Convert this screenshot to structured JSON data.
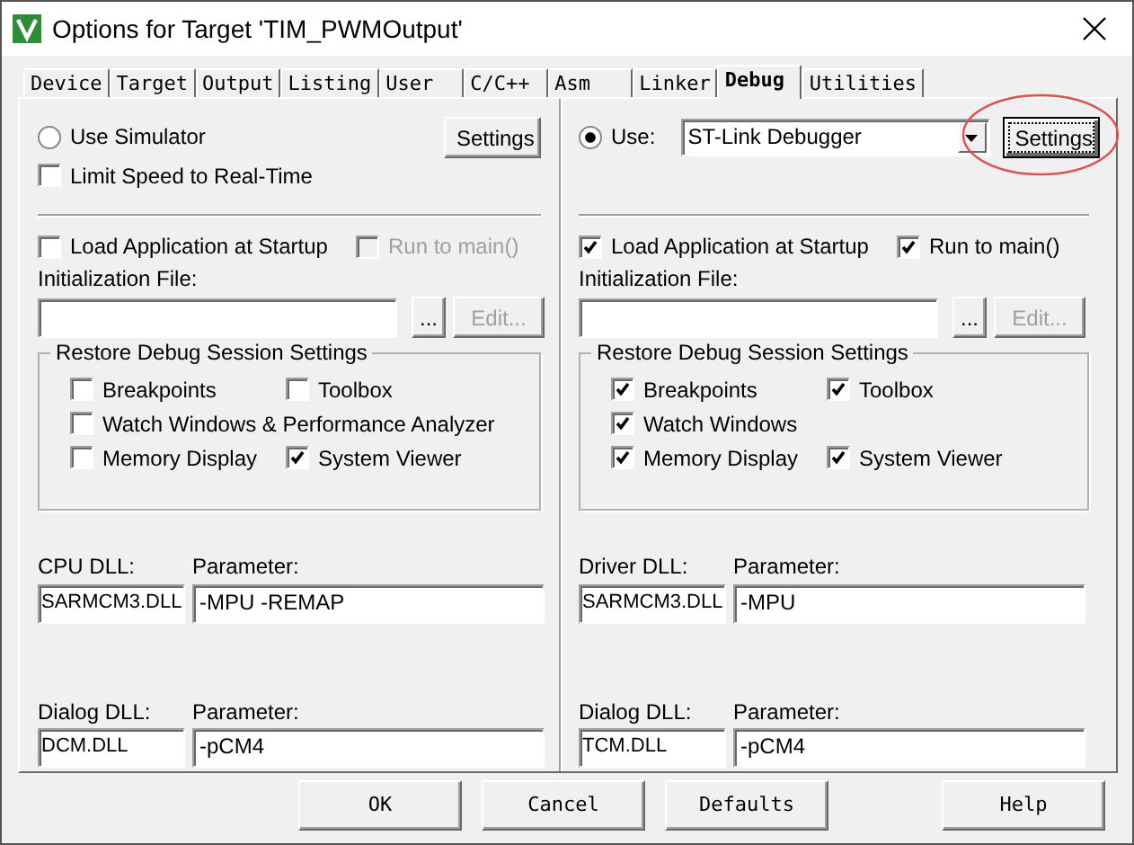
{
  "window": {
    "title": "Options for Target 'TIM_PWMOutput'"
  },
  "tabs": [
    {
      "label": "Device",
      "selected": false
    },
    {
      "label": "Target",
      "selected": false
    },
    {
      "label": "Output",
      "selected": false
    },
    {
      "label": "Listing",
      "selected": false
    },
    {
      "label": "User",
      "selected": false
    },
    {
      "label": "C/C++",
      "selected": false
    },
    {
      "label": "Asm",
      "selected": false
    },
    {
      "label": "Linker",
      "selected": false
    },
    {
      "label": "Debug",
      "selected": true
    },
    {
      "label": "Utilities",
      "selected": false
    }
  ],
  "panels": [
    {
      "radio": {
        "label": "Use Simulator",
        "selected": false
      },
      "settings_button": {
        "label": "Settings",
        "focused": false
      },
      "limit_speed": {
        "label": "Limit Speed to Real-Time",
        "checked": false
      },
      "load_app": {
        "label": "Load Application at Startup",
        "checked": false,
        "disabled": false
      },
      "run_to_main": {
        "label": "Run to main()",
        "checked": false,
        "disabled": true
      },
      "init_label": "Initialization File:",
      "browse_button": "...",
      "edit_button": {
        "label": "Edit...",
        "disabled": true
      },
      "restore": {
        "title": "Restore Debug Session Settings",
        "rows": [
          [
            {
              "label": "Breakpoints",
              "checked": false
            },
            {
              "label": "Toolbox",
              "checked": false
            }
          ],
          [
            {
              "label": "Watch Windows & Performance Analyzer",
              "checked": false
            }
          ],
          [
            {
              "label": "Memory Display",
              "checked": false
            },
            {
              "label": "System Viewer",
              "checked": true
            }
          ]
        ]
      },
      "dlls": [
        {
          "label": "CPU DLL:",
          "value": "SARMCM3.DLL",
          "param_label": "Parameter:",
          "param": "-MPU -REMAP"
        },
        {
          "label": "Dialog DLL:",
          "value": "DCM.DLL",
          "param_label": "Parameter:",
          "param": "-pCM4"
        }
      ]
    },
    {
      "radio": {
        "label": "Use:",
        "selected": true
      },
      "dropdown": {
        "value": "ST-Link Debugger"
      },
      "settings_button": {
        "label": "Settings",
        "focused": true,
        "circled": true
      },
      "load_app": {
        "label": "Load Application at Startup",
        "checked": true,
        "disabled": false
      },
      "run_to_main": {
        "label": "Run to main()",
        "checked": true,
        "disabled": false
      },
      "init_label": "Initialization File:",
      "browse_button": "...",
      "edit_button": {
        "label": "Edit...",
        "disabled": true
      },
      "restore": {
        "title": "Restore Debug Session Settings",
        "rows": [
          [
            {
              "label": "Breakpoints",
              "checked": true
            },
            {
              "label": "Toolbox",
              "checked": true
            }
          ],
          [
            {
              "label": "Watch Windows",
              "checked": true
            }
          ],
          [
            {
              "label": "Memory Display",
              "checked": true
            },
            {
              "label": "System Viewer",
              "checked": true
            }
          ]
        ]
      },
      "dlls": [
        {
          "label": "Driver DLL:",
          "value": "SARMCM3.DLL",
          "param_label": "Parameter:",
          "param": "-MPU"
        },
        {
          "label": "Dialog DLL:",
          "value": "TCM.DLL",
          "param_label": "Parameter:",
          "param": "-pCM4"
        }
      ]
    }
  ],
  "buttons": [
    {
      "label": "OK"
    },
    {
      "label": "Cancel"
    },
    {
      "label": "Defaults"
    },
    {
      "label": "Help"
    }
  ]
}
